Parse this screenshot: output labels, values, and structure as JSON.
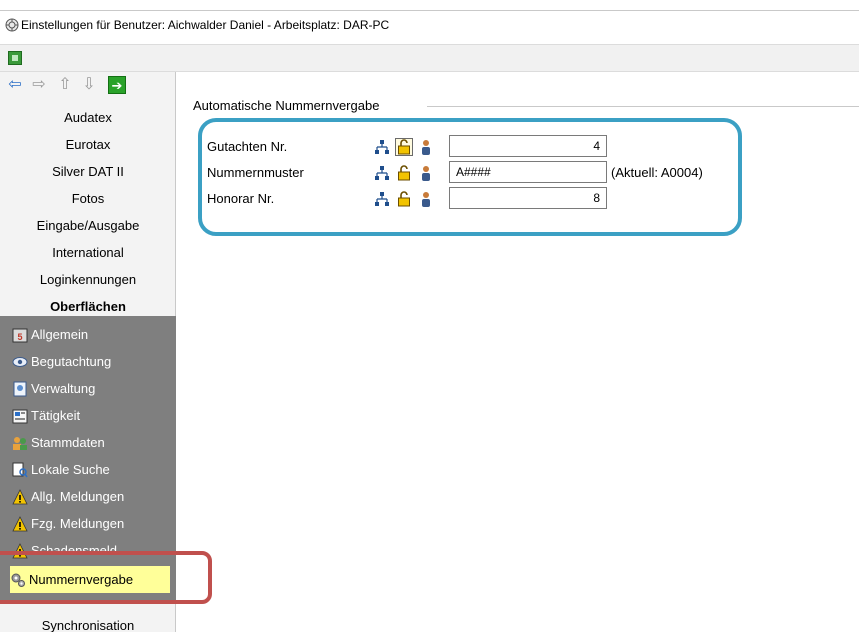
{
  "window": {
    "title": "Einstellungen für Benutzer: Aichwalder Daniel - Arbeitsplatz: DAR-PC"
  },
  "nav": {
    "categories": [
      {
        "label": "Audatex"
      },
      {
        "label": "Eurotax"
      },
      {
        "label": "Silver DAT II"
      },
      {
        "label": "Fotos"
      },
      {
        "label": "Eingabe/Ausgabe"
      },
      {
        "label": "International"
      },
      {
        "label": "Loginkennungen"
      },
      {
        "label": "Oberflächen"
      }
    ],
    "subitems": [
      {
        "label": "Allgemein",
        "icon": "calendar-icon"
      },
      {
        "label": "Begutachtung",
        "icon": "eye-icon"
      },
      {
        "label": "Verwaltung",
        "icon": "document-icon"
      },
      {
        "label": "Tätigkeit",
        "icon": "clipboard-icon"
      },
      {
        "label": "Stammdaten",
        "icon": "people-icon"
      },
      {
        "label": "Lokale Suche",
        "icon": "search-document-icon"
      },
      {
        "label": "Allg. Meldungen",
        "icon": "warning-icon"
      },
      {
        "label": "Fzg. Meldungen",
        "icon": "warning-icon"
      },
      {
        "label": "Schadensmeld.",
        "icon": "warning-icon"
      },
      {
        "label": "Nummernvergabe",
        "icon": "gears-icon"
      }
    ],
    "bottom": "Synchronisation"
  },
  "main": {
    "group_title": "Automatische Nummernvergabe",
    "rows": [
      {
        "label": "Gutachten Nr.",
        "value": "4",
        "align": "right",
        "suffix": ""
      },
      {
        "label": "Nummernmuster",
        "value": "A####",
        "align": "left",
        "suffix": "(Aktuell: A0004)"
      },
      {
        "label": "Honorar Nr.",
        "value": "8",
        "align": "right",
        "suffix": ""
      }
    ]
  },
  "colors": {
    "highlight_blue": "#3ba0c4",
    "highlight_red": "#c0504d",
    "selected_item": "#ffff99",
    "nav_panel": "#7f7f7f"
  }
}
